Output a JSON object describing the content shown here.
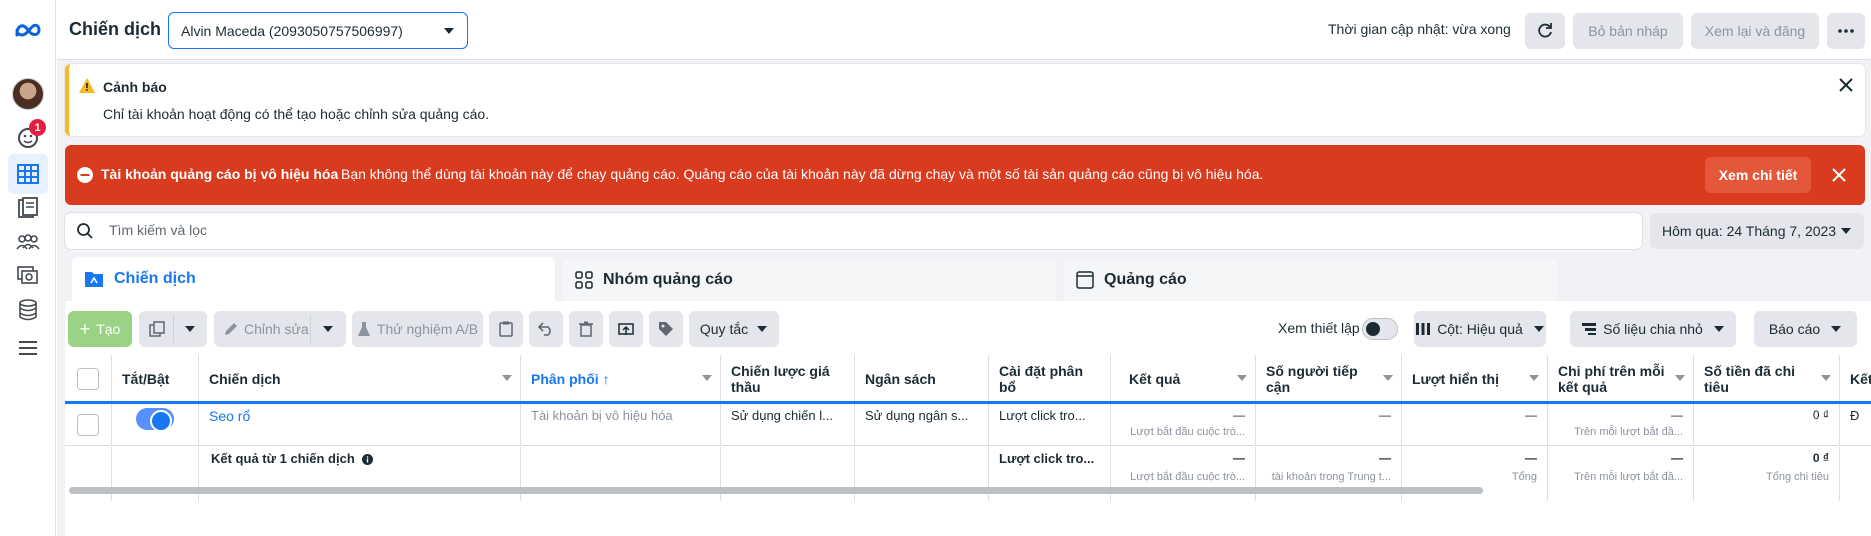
{
  "sidebar": {
    "notification_count": "1",
    "items": [
      {
        "icon": "meta-logo-icon"
      },
      {
        "icon": "avatar"
      },
      {
        "icon": "notifications-icon"
      },
      {
        "icon": "campaigns-table-icon",
        "active": true
      },
      {
        "icon": "pages-icon"
      },
      {
        "icon": "audiences-icon"
      },
      {
        "icon": "creative-hub-icon"
      },
      {
        "icon": "database-icon"
      },
      {
        "icon": "menu-icon"
      }
    ]
  },
  "header": {
    "title": "Chiến dịch",
    "account_select_value": "Alvin Maceda (2093050757506997)",
    "update_status": "Thời gian cập nhật: vừa xong",
    "discard_draft_label": "Bỏ bản nháp",
    "review_publish_label": "Xem lại và đăng"
  },
  "warning": {
    "title": "Cảnh báo",
    "body": "Chỉ tài khoản hoạt động có thể tạo hoặc chỉnh sửa quảng cáo."
  },
  "error": {
    "title": "Tài khoản quảng cáo bị vô hiệu hóa",
    "body": "Bạn không thể dùng tài khoản này để chạy quảng cáo. Quảng cáo của tài khoản này đã dừng chạy và một số tài sản quảng cáo cũng bị vô hiệu hóa.",
    "details_button": "Xem chi tiết"
  },
  "search": {
    "placeholder": "Tìm kiếm và lọc",
    "date_range": "Hôm qua: 24 Tháng 7, 2023"
  },
  "tabs": [
    {
      "label": "Chiến dịch",
      "active": true
    },
    {
      "label": "Nhóm quảng cáo",
      "active": false
    },
    {
      "label": "Quảng cáo",
      "active": false
    }
  ],
  "toolbar": {
    "create": "Tạo",
    "edit": "Chỉnh sửa",
    "ab_test": "Thử nghiệm A/B",
    "rules": "Quy tắc",
    "view_setup": "Xem thiết lập",
    "columns": "Cột: Hiệu quả",
    "breakdown": "Số liệu chia nhỏ",
    "reports": "Báo cáo"
  },
  "table": {
    "headers": {
      "toggle": "Tắt/Bật",
      "campaign": "Chiến dịch",
      "delivery": "Phân phối ↑",
      "bid_strategy": "Chiến lược giá thầu",
      "budget": "Ngân sách",
      "attribution": "Cài đặt phân bổ",
      "results": "Kết quả",
      "reach": "Số người tiếp cận",
      "impressions": "Lượt hiển thị",
      "cost_per_result": "Chi phí trên mỗi kết quả",
      "amount_spent": "Số tiền đã chi tiêu",
      "ends": "Kết"
    },
    "row": {
      "campaign": "Seo rổ",
      "delivery": "Tài khoản bị vô hiệu hóa",
      "bid_strategy": "Sử dụng chiến l...",
      "budget": "Sử dụng ngân s...",
      "attribution": "Lượt click tro...",
      "results": "—",
      "results_sub": "Lượt bắt đầu cuộc trò...",
      "reach": "—",
      "impressions": "—",
      "cost_per_result": "—",
      "cost_per_result_sub": "Trên mỗi lượt bắt đầ...",
      "amount_spent": "0 ₫",
      "ends": "Đ"
    },
    "summary": {
      "label": "Kết quả từ 1 chiến dịch",
      "attribution": "Lượt click tro...",
      "results": "—",
      "results_sub": "Lượt bắt đầu cuộc trò...",
      "reach": "—",
      "reach_sub": "tài khoản trong Trung t...",
      "impressions": "—",
      "impressions_sub": "Tổng",
      "cost_per_result": "—",
      "cost_per_result_sub": "Trên mỗi lượt bắt đầ...",
      "amount_spent": "0 ₫",
      "amount_spent_sub": "Tổng chi tiêu"
    }
  },
  "colors": {
    "primary": "#1877f2",
    "error_banner": "#d93b1f",
    "warning_accent": "#f7b928",
    "create_button": "#9bd386"
  }
}
